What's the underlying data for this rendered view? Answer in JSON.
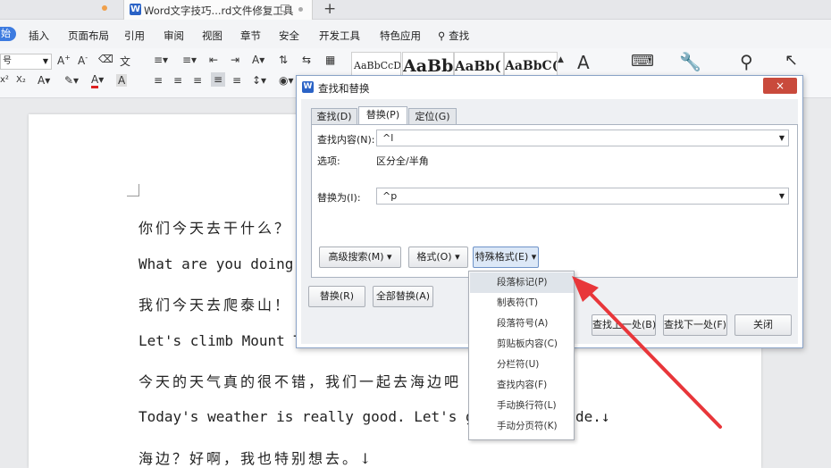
{
  "tabbar": {
    "doc_tab_title": "Word文字技巧...rd文件修复工具",
    "new_tab": "+"
  },
  "menubar": {
    "start": "始",
    "items": [
      "插入",
      "页面布局",
      "引用",
      "审阅",
      "视图",
      "章节",
      "安全",
      "开发工具",
      "特色应用"
    ],
    "search": "查找"
  },
  "ribbon": {
    "font_size": "号",
    "styles": [
      "AaBbCcDd",
      "AaBb",
      "AaBb(",
      "AaBbC("
    ]
  },
  "document": {
    "lines": [
      "你们今天去干什么？",
      "What are you doing",
      "我们今天去爬泰山！",
      "Let's climb Mount T",
      "今天的天气真的很不错，我们一起去海边吧",
      "Today's weather is really good. Let's go",
      "海边？好啊，我也特别想去。↓"
    ],
    "line6_tail": "de.↓"
  },
  "dialog": {
    "title": "查找和替换",
    "close_label": "×",
    "tabs": [
      "查找(D)",
      "替换(P)",
      "定位(G)"
    ],
    "active_tab": 1,
    "find_label": "查找内容(N):",
    "find_value": "^l",
    "options_label": "选项:",
    "options_value": "区分全/半角",
    "replace_label": "替换为(I):",
    "replace_value": "^p",
    "buttons": {
      "advanced": "高级搜索(M) ▾",
      "format": "格式(O) ▾",
      "special": "特殊格式(E) ▾",
      "replace": "替换(R)",
      "replace_all": "全部替换(A)",
      "find_prev": "查找上一处(B)",
      "find_next": "查找下一处(F)",
      "close": "关闭"
    }
  },
  "dropdown": {
    "items": [
      "段落标记(P)",
      "制表符(T)",
      "段落符号(A)",
      "剪贴板内容(C)",
      "分栏符(U)",
      "查找内容(F)",
      "手动换行符(L)",
      "手动分页符(K)"
    ],
    "highlighted": 0
  },
  "colors": {
    "accent": "#3d7be0",
    "close_red": "#c94a3c",
    "arrow_red": "#e8363a"
  }
}
